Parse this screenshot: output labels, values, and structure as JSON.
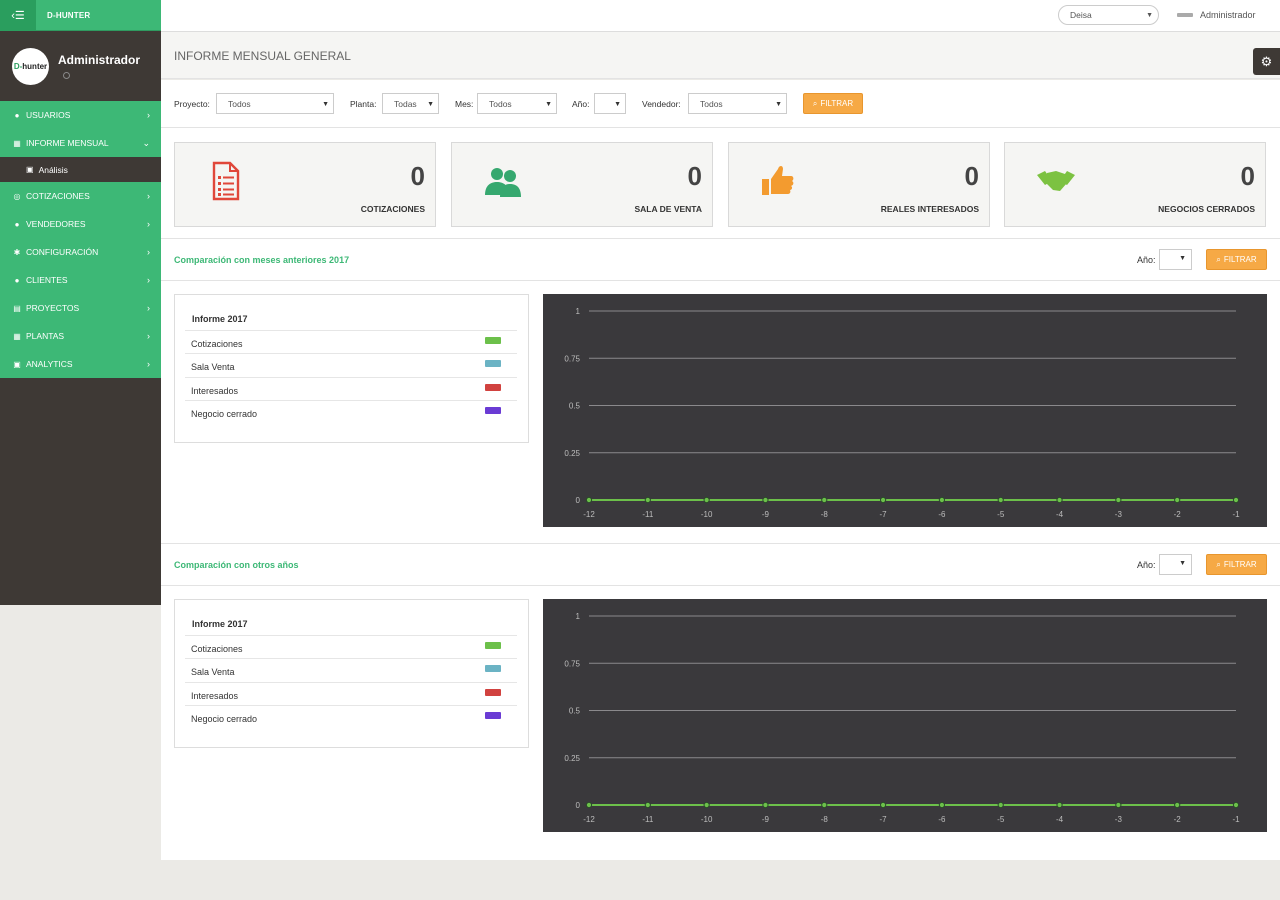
{
  "brand": {
    "name": "D-HUNTER"
  },
  "profile": {
    "name": "Administrador",
    "logo_prefix": "D-",
    "logo_suffix": "hunter"
  },
  "menu": {
    "usuarios": "USUARIOS",
    "informe": "INFORME MENSUAL",
    "analisis": "Análisis",
    "cotizaciones": "COTIZACIONES",
    "vendedores": "VENDEDORES",
    "configuracion": "CONFIGURACIÓN",
    "clientes": "CLIENTES",
    "proyectos": "PROYECTOS",
    "plantas": "PLANTAS",
    "analytics": "ANALYTICS"
  },
  "topbar": {
    "company": "Deisa",
    "user": "Administrador"
  },
  "page": {
    "title": "INFORME MENSUAL GENERAL"
  },
  "filters": {
    "proyecto_label": "Proyecto:",
    "proyecto_value": "Todos",
    "planta_label": "Planta:",
    "planta_value": "Todas",
    "mes_label": "Mes:",
    "mes_value": "Todos",
    "ano_label": "Año:",
    "ano_value": "",
    "vendedor_label": "Vendedor:",
    "vendedor_value": "Todos",
    "filter_button": "FILTRAR"
  },
  "stats": [
    {
      "value": "0",
      "label": "COTIZACIONES",
      "icon": "document-list-icon",
      "color": "#e0473a"
    },
    {
      "value": "0",
      "label": "SALA DE VENTA",
      "icon": "users-icon",
      "color": "#36a86f"
    },
    {
      "value": "0",
      "label": "REALES INTERESADOS",
      "icon": "thumbs-up-icon",
      "color": "#f39b2f"
    },
    {
      "value": "0",
      "label": "NEGOCIOS CERRADOS",
      "icon": "handshake-icon",
      "color": "#7cc241"
    }
  ],
  "section1": {
    "title": "Comparación con meses anteriores 2017",
    "ano_label": "Año:",
    "filter_button": "FILTRAR"
  },
  "section2": {
    "title": "Comparación con otros años",
    "ano_label": "Año:",
    "filter_button": "FILTRAR"
  },
  "legend": {
    "title": "Informe 2017",
    "items": [
      {
        "name": "Cotizaciones",
        "color": "#6cc04a"
      },
      {
        "name": "Sala Venta",
        "color": "#6bb3c4"
      },
      {
        "name": "Interesados",
        "color": "#d1423f"
      },
      {
        "name": "Negocio cerrado",
        "color": "#6a3bd4"
      }
    ]
  },
  "chart_data": [
    {
      "type": "line",
      "x": [
        -12,
        -11,
        -10,
        -9,
        -8,
        -7,
        -6,
        -5,
        -4,
        -3,
        -2,
        -1
      ],
      "series": [
        {
          "values": [
            0,
            0,
            0,
            0,
            0,
            0,
            0,
            0,
            0,
            0,
            0,
            0
          ],
          "color": "#6cc04a"
        }
      ],
      "ylim": [
        0,
        1
      ],
      "yticks": [
        "1",
        "0.75",
        "0.5",
        "0.25",
        "0"
      ],
      "xticks": [
        "-12",
        "-11",
        "-10",
        "-9",
        "-8",
        "-7",
        "-6",
        "-5",
        "-4",
        "-3",
        "-2",
        "-1"
      ],
      "grid": true,
      "background": "#3a393c"
    },
    {
      "type": "line",
      "x": [
        -12,
        -11,
        -10,
        -9,
        -8,
        -7,
        -6,
        -5,
        -4,
        -3,
        -2,
        -1
      ],
      "series": [
        {
          "values": [
            0,
            0,
            0,
            0,
            0,
            0,
            0,
            0,
            0,
            0,
            0,
            0
          ],
          "color": "#6cc04a"
        }
      ],
      "ylim": [
        0,
        1
      ],
      "yticks": [
        "1",
        "0.75",
        "0.5",
        "0.25",
        "0"
      ],
      "xticks": [
        "-12",
        "-11",
        "-10",
        "-9",
        "-8",
        "-7",
        "-6",
        "-5",
        "-4",
        "-3",
        "-2",
        "-1"
      ],
      "grid": true,
      "background": "#3a393c"
    }
  ]
}
